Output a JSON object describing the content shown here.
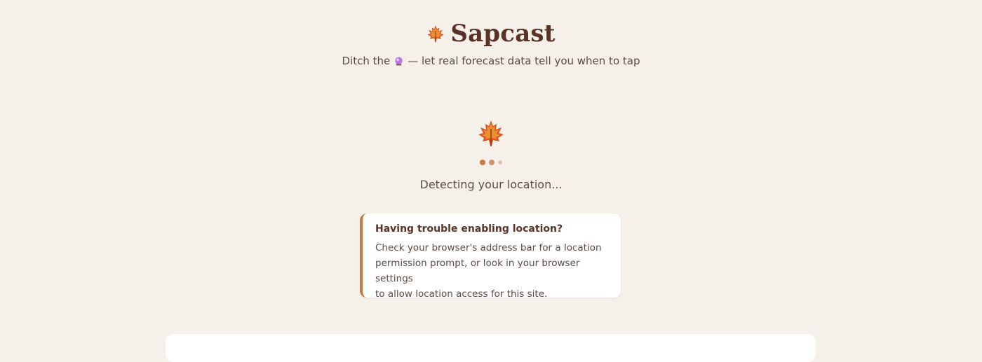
{
  "header": {
    "logo_icon": "maple-leaf-icon",
    "title": "Sapcast",
    "tagline_before": "Ditch the",
    "tagline_icon": "crystal-ball-icon",
    "tagline_after": "— let real forecast data tell you when to tap"
  },
  "loader": {
    "icon": "maple-leaf-icon",
    "status_text": "Detecting your location..."
  },
  "help_card": {
    "title": "Having trouble enabling location?",
    "line1": "Check your browser's address bar for a location",
    "line2": "permission prompt, or look in your browser settings",
    "line3": "to allow location access for this site."
  },
  "colors": {
    "background": "#f5f0ea",
    "brand_brown": "#5a3326",
    "accent_orange": "#c47a40",
    "card": "#ffffff"
  }
}
